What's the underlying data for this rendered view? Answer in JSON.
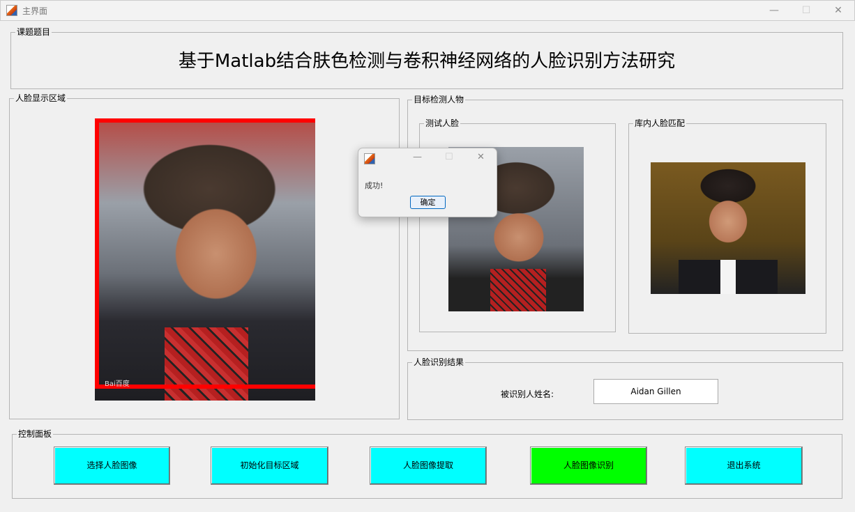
{
  "window": {
    "title": "主界面",
    "minimize": "—",
    "maximize": "☐",
    "close": "✕"
  },
  "title_panel": {
    "legend": "课题题目",
    "title": "基于Matlab结合肤色检测与卷积神经网络的人脸识别方法研究"
  },
  "face_display": {
    "legend": "人脸显示区域",
    "watermark": "Bai百度"
  },
  "target": {
    "legend": "目标检测人物",
    "test_face": "测试人脸",
    "db_match": "库内人脸匹配"
  },
  "result": {
    "legend": "人脸识别结果",
    "name_label": "被识别人姓名:",
    "name_value": "Aidan Gillen"
  },
  "controls": {
    "legend": "控制面板",
    "buttons": [
      {
        "label": "选择人脸图像",
        "color": "#00ffff"
      },
      {
        "label": "初始化目标区域",
        "color": "#00ffff"
      },
      {
        "label": "人脸图像提取",
        "color": "#00ffff"
      },
      {
        "label": "人脸图像识别",
        "color": "#00ff00"
      },
      {
        "label": "退出系统",
        "color": "#00ffff"
      }
    ]
  },
  "dialog": {
    "message": "成功!",
    "ok": "确定"
  }
}
